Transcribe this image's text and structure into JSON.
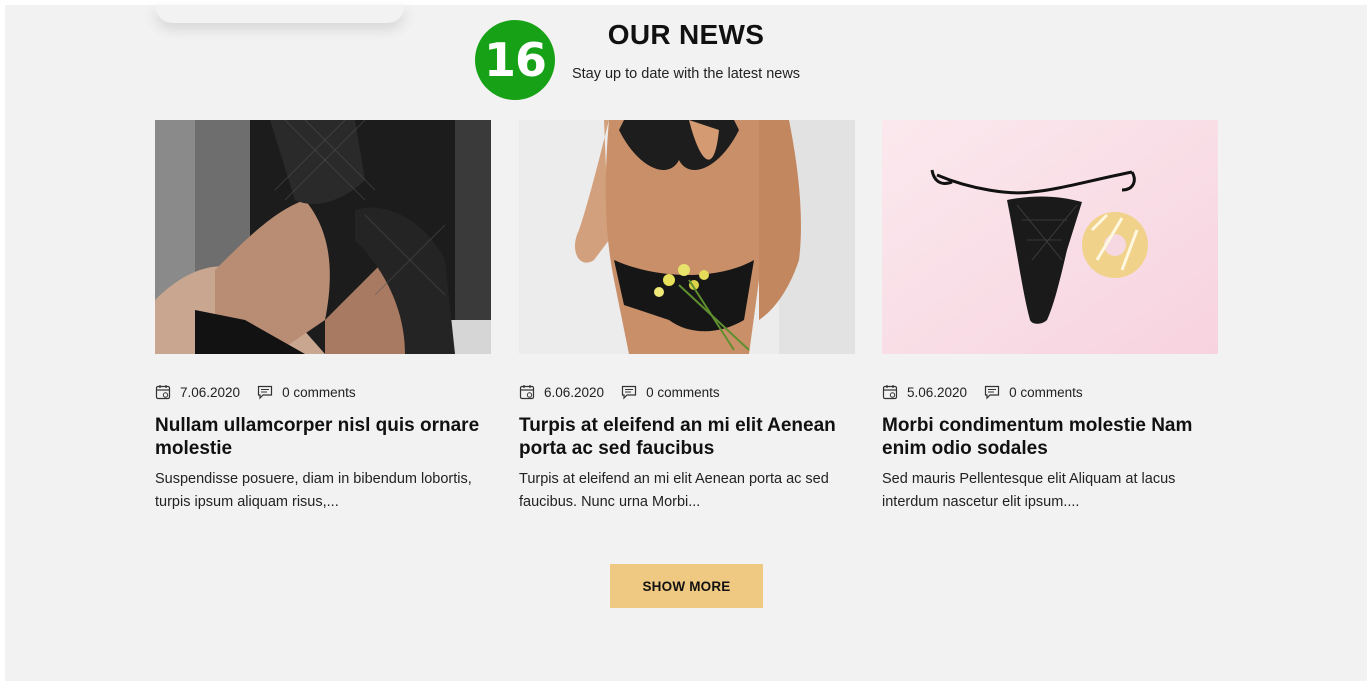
{
  "section": {
    "badge_number": "16",
    "title": "OUR NEWS",
    "subtitle": "Stay up to date with the latest news"
  },
  "posts": [
    {
      "date": "7.06.2020",
      "comments": "0 comments",
      "title": "Nullam ullamcorper nisl quis ornare molestie",
      "excerpt": "Suspendisse posuere, diam in bibendum lobortis, turpis ipsum aliquam risus,..."
    },
    {
      "date": "6.06.2020",
      "comments": "0 comments",
      "title": "Turpis at eleifend an mi elit Aenean porta ac sed faucibus",
      "excerpt": "Turpis at eleifend an mi elit Aenean porta ac sed faucibus. Nunc urna Morbi..."
    },
    {
      "date": "5.06.2020",
      "comments": "0 comments",
      "title": "Morbi condimentum molestie Nam enim odio sodales",
      "excerpt": "Sed mauris Pellentesque elit Aliquam at lacus interdum nascetur elit ipsum...."
    }
  ],
  "show_more_label": "SHOW MORE",
  "colors": {
    "badge": "#17a116",
    "button": "#efc981",
    "background": "#f2f2f2"
  },
  "icons": {
    "date": "calendar-icon",
    "comments": "comment-icon"
  }
}
